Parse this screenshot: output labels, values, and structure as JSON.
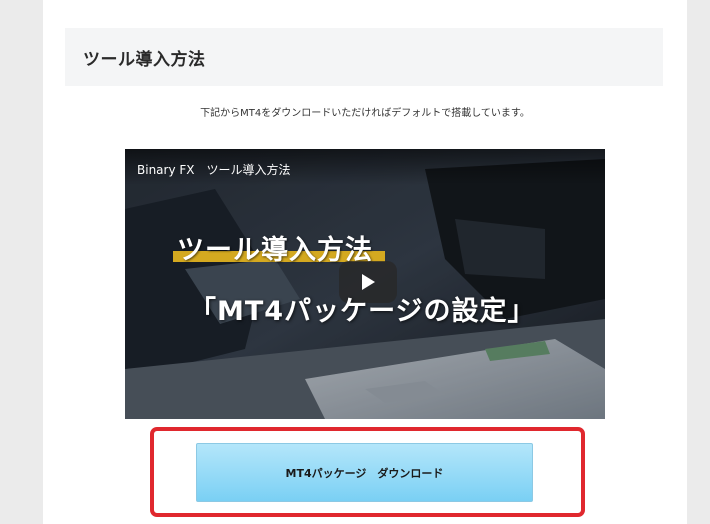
{
  "section": {
    "title": "ツール導入方法"
  },
  "intro": {
    "text": "下記からMT4をダウンロードいただければデフォルトで搭載しています。"
  },
  "video": {
    "title": "Binary FX　ツール導入方法",
    "heading": "ツール導入方法",
    "subheading": "「MT4パッケージの設定」",
    "play_icon": "play-icon",
    "accent_color": "#d4a920"
  },
  "download": {
    "button_label": "MT4パッケージ　ダウンロード",
    "highlight_color": "#e0282e"
  }
}
